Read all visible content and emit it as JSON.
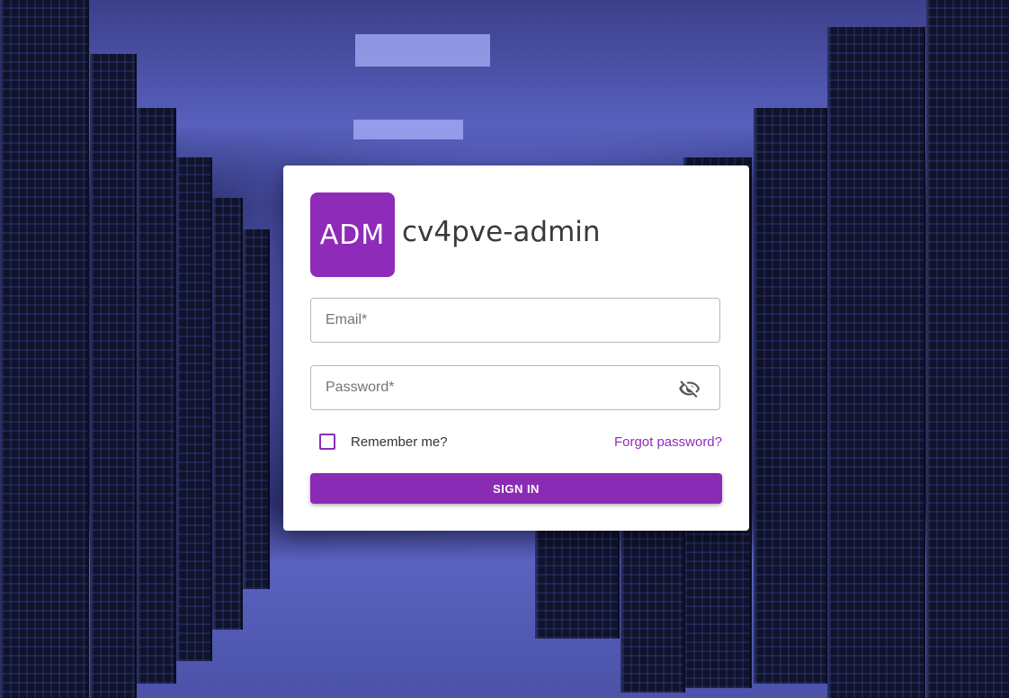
{
  "brand": {
    "logo_text": "ADM",
    "app_name": "cv4pve-admin",
    "accent_color": "#8e2bb8"
  },
  "login_form": {
    "email_placeholder": "Email*",
    "password_placeholder": "Password*",
    "password_toggle_icon": "eye-off-icon",
    "remember_label": "Remember me?",
    "remember_checked": false,
    "forgot_link": "Forgot password?",
    "submit_label": "SIGN IN"
  }
}
